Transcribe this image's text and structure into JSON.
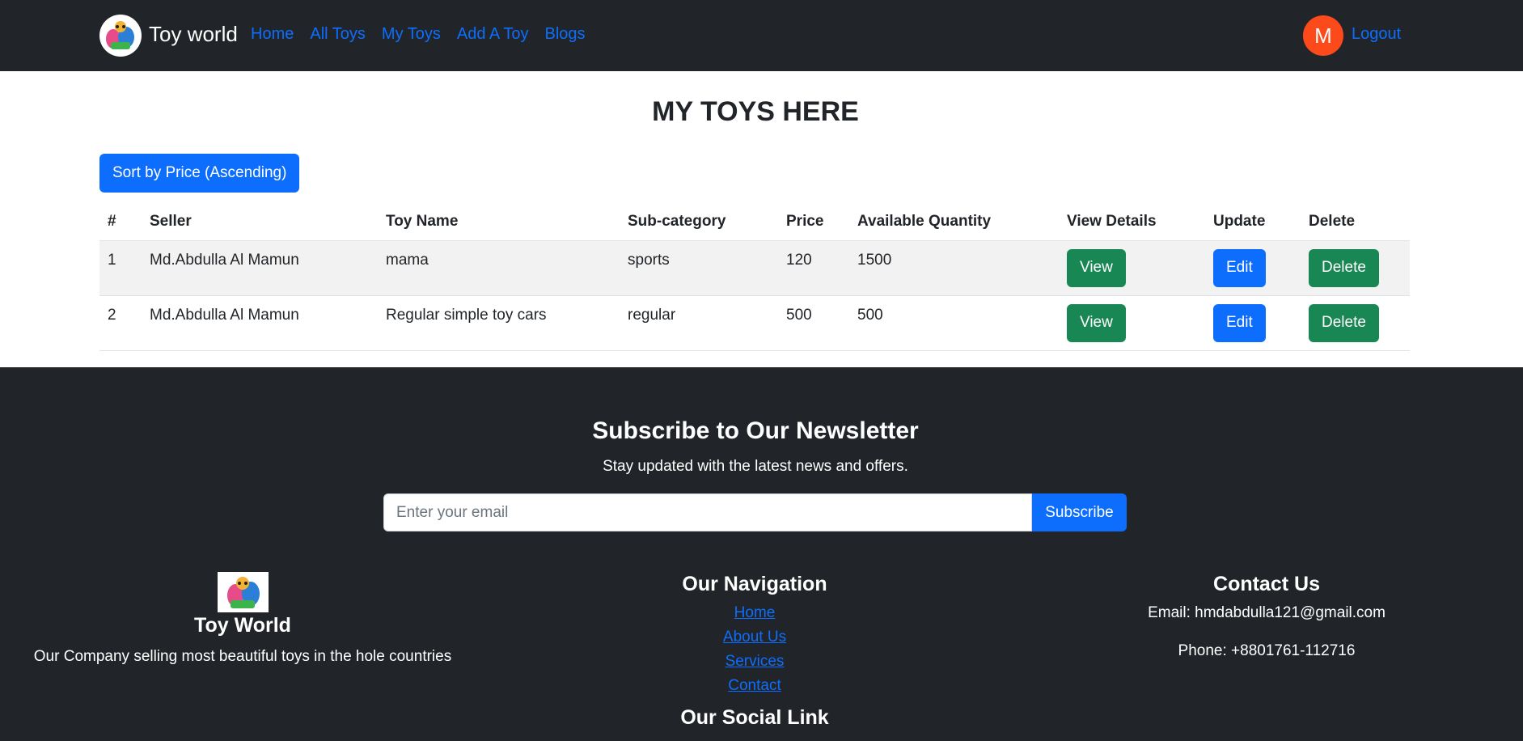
{
  "navbar": {
    "brand": "Toy world",
    "logo_icon": "toy-shop-logo-icon",
    "links": [
      "Home",
      "All Toys",
      "My Toys",
      "Add A Toy",
      "Blogs"
    ],
    "avatar_initial": "M",
    "logout": "Logout",
    "colors": {
      "background": "#212529",
      "link": "#0d6efd",
      "avatar": "#fc4a1a"
    }
  },
  "main": {
    "title": "MY TOYS HERE",
    "sort_button": "Sort by Price (Ascending)",
    "table": {
      "headers": [
        "#",
        "Seller",
        "Toy Name",
        "Sub-category",
        "Price",
        "Available Quantity",
        "View Details",
        "Update",
        "Delete"
      ],
      "rows": [
        {
          "num": "1",
          "seller": "Md.Abdulla Al Mamun",
          "toy_name": "mama",
          "sub_category": "sports",
          "price": "120",
          "quantity": "1500",
          "view": "View",
          "edit": "Edit",
          "delete": "Delete"
        },
        {
          "num": "2",
          "seller": "Md.Abdulla Al Mamun",
          "toy_name": "Regular simple toy cars",
          "sub_category": "regular",
          "price": "500",
          "quantity": "500",
          "view": "View",
          "edit": "Edit",
          "delete": "Delete"
        }
      ]
    },
    "colors": {
      "primary": "#0d6efd",
      "success": "#198754"
    }
  },
  "footer": {
    "newsletter": {
      "title": "Subscribe to Our Newsletter",
      "subtitle": "Stay updated with the latest news and offers.",
      "placeholder": "Enter your email",
      "button": "Subscribe"
    },
    "about": {
      "logo_icon": "toy-shop-logo-icon",
      "title": "Toy World",
      "text": "Our Company selling most beautiful toys in the hole countries"
    },
    "navigation": {
      "title": "Our Navigation",
      "links": [
        "Home",
        "About Us",
        "Services",
        "Contact"
      ],
      "social_title": "Our Social Link"
    },
    "contact": {
      "title": "Contact Us",
      "email": "Email: hmdabdulla121@gmail.com",
      "phone": "Phone: +8801761-112716"
    },
    "colors": {
      "background": "#212529"
    }
  }
}
